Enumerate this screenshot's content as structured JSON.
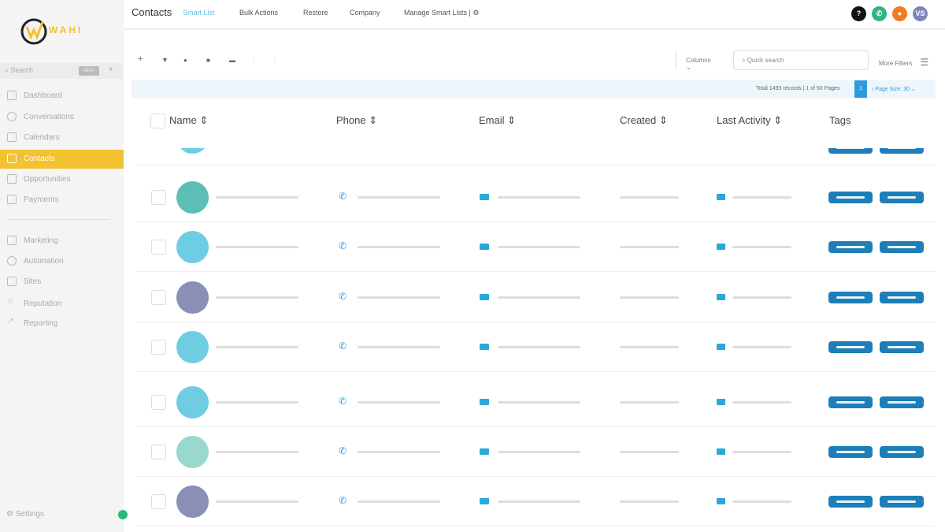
{
  "sidebar": {
    "logo_text": "WAHI",
    "search_placeholder": "Search",
    "search_shortcut": "ctrl K",
    "items": [
      {
        "label": "Dashboard"
      },
      {
        "label": "Conversations"
      },
      {
        "label": "Calendars"
      },
      {
        "label": "Contacts"
      },
      {
        "label": "Opportunities"
      },
      {
        "label": "Payments"
      },
      {
        "label": "Marketing"
      },
      {
        "label": "Automation"
      },
      {
        "label": "Sites"
      },
      {
        "label": "Reputation"
      },
      {
        "label": "Reporting"
      }
    ],
    "settings": "Settings"
  },
  "header": {
    "title": "Contacts",
    "tabs": [
      "Smart List",
      "Bulk Actions",
      "Restore",
      "Company",
      "Manage Smart Lists | ⚙"
    ],
    "avatar_initials": "VS",
    "icon_colors": [
      "#111111",
      "#2cb67d",
      "#f07b22",
      "#7f84b8"
    ]
  },
  "toolbar": {
    "columns_label": "Columns",
    "search_placeholder": "Quick search",
    "more_filters": "More Filters"
  },
  "pagination": {
    "summary": "Total 1493 records | 1 of 50 Pages",
    "current_page": "1",
    "page_size": "Page Size: 30"
  },
  "table": {
    "headers": [
      "Name",
      "Phone",
      "Email",
      "Created",
      "Last Activity",
      "Tags"
    ],
    "avatar_colors": [
      "#5bbfb5",
      "#6fcde3",
      "#8a8fb8",
      "#6fcde3",
      "#6fcde3",
      "#98d8cf",
      "#8a8fb8"
    ]
  }
}
